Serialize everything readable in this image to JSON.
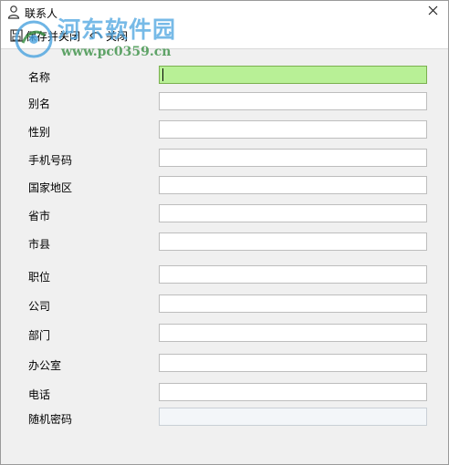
{
  "window": {
    "title": "联系人"
  },
  "toolbar": {
    "save_close_label": "保存并关闭",
    "close_label": "关闭"
  },
  "watermark": {
    "name": "河东软件园",
    "url": "www.pc0359.cn"
  },
  "form": {
    "fields": [
      {
        "label": "名称",
        "value": ""
      },
      {
        "label": "别名",
        "value": ""
      },
      {
        "label": "性别",
        "value": ""
      },
      {
        "label": "手机号码",
        "value": ""
      },
      {
        "label": "国家地区",
        "value": ""
      },
      {
        "label": "省市",
        "value": ""
      },
      {
        "label": "市县",
        "value": ""
      },
      {
        "label": "职位",
        "value": ""
      },
      {
        "label": "公司",
        "value": ""
      },
      {
        "label": "部门",
        "value": ""
      },
      {
        "label": "办公室",
        "value": ""
      },
      {
        "label": "电话",
        "value": ""
      },
      {
        "label": "随机密码",
        "value": ""
      }
    ]
  }
}
